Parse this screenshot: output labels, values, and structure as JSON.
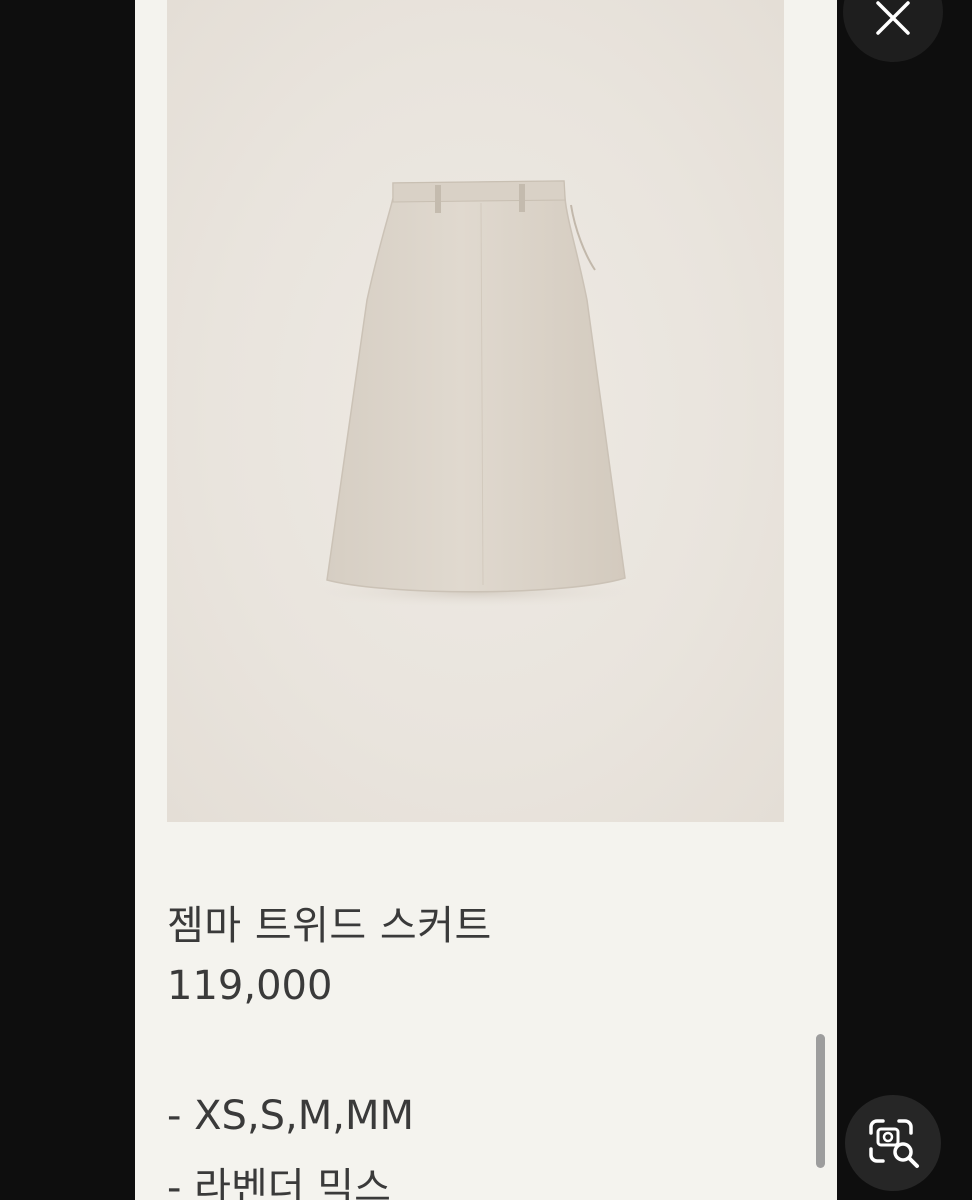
{
  "product": {
    "name": "젬마 트위드 스커트",
    "price": "119,000",
    "options": [
      "- XS,S,M,MM",
      "- 라벤더 믹스"
    ],
    "image": {
      "subject": "beige a-line midi skirt",
      "background_color": "#ebe6df",
      "skirt_color": "#dcd4ca"
    }
  },
  "controls": {
    "close_icon": "close-icon",
    "lens_icon": "visual-search-icon"
  },
  "colors": {
    "page_background": "#f4f3ee",
    "outer_background": "#0e0e0e",
    "text": "#3a3a3a",
    "button_background": "#1e1e1e"
  }
}
